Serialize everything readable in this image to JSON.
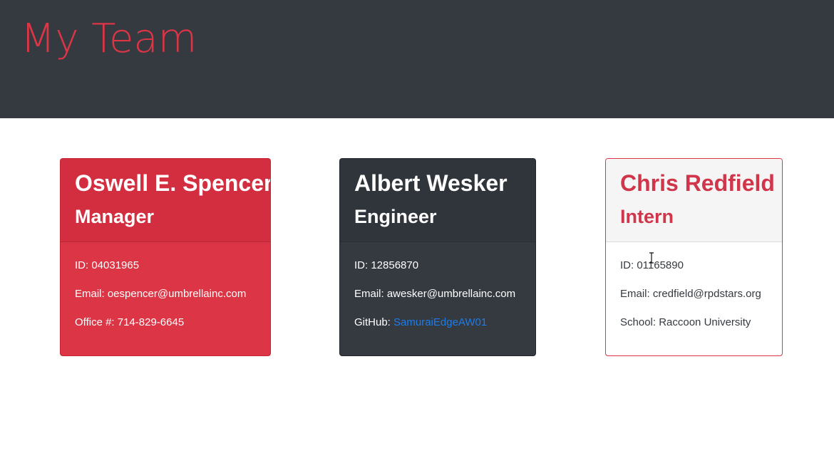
{
  "header": {
    "title": "My Team"
  },
  "colors": {
    "header_bg": "#343a40",
    "accent_red": "#dc3545",
    "dark": "#343a40",
    "link_blue": "#1e7ce8"
  },
  "team": {
    "manager": {
      "name": "Oswell E. Spencer",
      "role": "Manager",
      "id_text": "ID: 04031965",
      "email_label": "Email: ",
      "email": "oespencer@umbrellainc.com",
      "extra_text": "Office #: 714-829-6645"
    },
    "engineer": {
      "name": "Albert Wesker",
      "role": "Engineer",
      "id_text": "ID: 12856870",
      "email_label": "Email: ",
      "email": "awesker@umbrellainc.com",
      "github_label": "GitHub: ",
      "github": "SamuraiEdgeAW01"
    },
    "intern": {
      "name": "Chris Redfield",
      "role": "Intern",
      "id_text": "ID: 01165890",
      "email_label": "Email: ",
      "email": "credfield@rpdstars.org",
      "extra_text": "School: Raccoon University"
    }
  }
}
